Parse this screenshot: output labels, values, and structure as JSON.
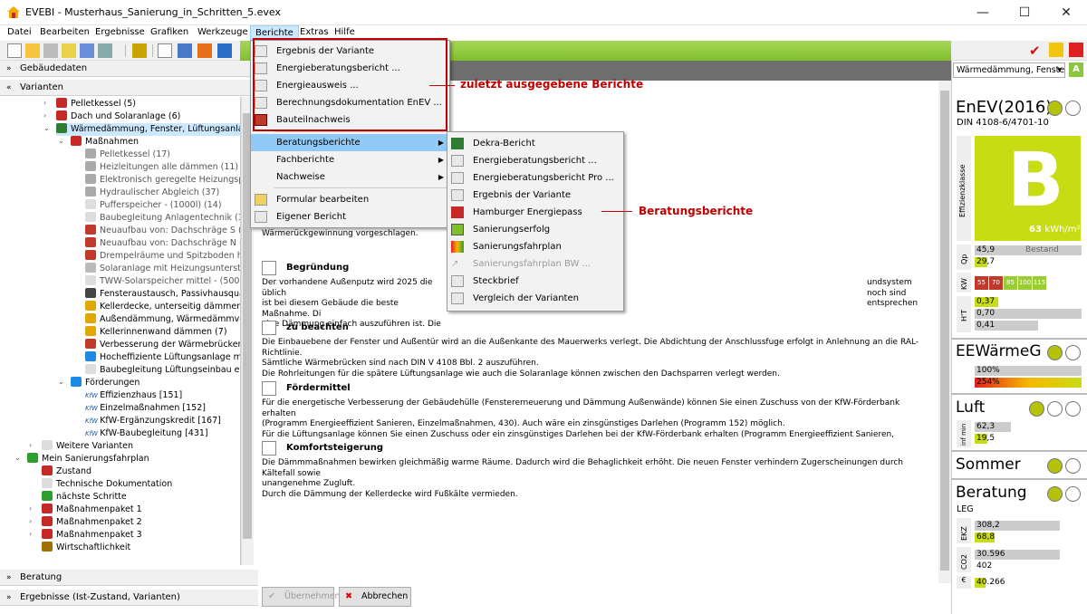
{
  "window": {
    "title": "EVEBI - Musterhaus_Sanierung_in_Schritten_5.evex",
    "min": "—",
    "max": "☐",
    "close": "✕"
  },
  "menubar": [
    "Datei",
    "Bearbeiten",
    "Ergebnisse",
    "Grafiken",
    "Werkzeuge",
    "Berichte",
    "Extras",
    "Hilfe"
  ],
  "left": {
    "gebaeudedaten": "Gebäudedaten",
    "varianten": "Varianten",
    "beratung": "Beratung",
    "ergebnisse": "Ergebnisse (Ist-Zustand, Varianten)"
  },
  "tree": [
    "Pelletkessel (5)",
    "Dach und Solaranlage (6)",
    "Wärmedämmung, Fenster, Lüftungsanlage (",
    "Maßnahmen",
    "Pelletkessel (17)",
    "Heizleitungen alle dämmen (11)",
    "Elektronisch geregelte Heizungspump",
    "Hydraulischer Abgleich (37)",
    "Pufferspeicher - (1000l) (14)",
    "Baubegleitung Anlagentechnik (36)",
    "Neuaufbau von: Dachschräge S (8)",
    "Neuaufbau von: Dachschräge N (9)",
    "Drempelräume und Spitzboden hinzu",
    "Solaranlage mit Heizungsunterstütz",
    "TWW-Solarspeicher mittel - (500 l) (2",
    "Fensteraustausch, Passivhausqualitä",
    "Kellerdecke, unterseitig dämmen (1)",
    "Außendämmung, Wärmedämmverbu",
    "Kellerinnenwand dämmen (7)",
    "Verbesserung der Wärmebrücken, pa",
    "Hocheffiziente Lüftungsanlage mit W",
    "Baubegleitung Lüftungseinbau etc. (",
    "Förderungen",
    "Effizienzhaus [151]",
    "Einzelmaßnahmen [152]",
    "KfW-Ergänzungskredit [167]",
    "KfW-Baubegleitung [431]",
    "Weitere Varianten",
    "Mein Sanierungsfahrplan",
    "Zustand",
    "Technische Dokumentation",
    "nächste Schritte",
    "Maßnahmenpaket 1",
    "Maßnahmenpaket 2",
    "Maßnahmenpaket 3",
    "Wirtschaftlichkeit"
  ],
  "kfw_prefix": "KfW",
  "berichte_menu": {
    "recent": [
      "Ergebnis der Variante",
      "Energieberatungsbericht ...",
      "Energieausweis ...",
      "Berechnungsdokumentation EnEV ...",
      "Bauteilnachweis"
    ],
    "sub": [
      "Beratungsberichte",
      "Fachberichte",
      "Nachweise"
    ],
    "other": [
      "Formular bearbeiten",
      "Eigener Bericht"
    ]
  },
  "beratungsberichte_menu": [
    "Dekra-Bericht",
    "Energieberatungsbericht ...",
    "Energieberatungsbericht Pro ...",
    "Ergebnis der Variante",
    "Hamburger Energiepass",
    "Sanierungserfolg",
    "Sanierungsfahrplan",
    "Sanierungsfahrplan BW ...",
    "Steckbrief",
    "Vergleich der Varianten"
  ],
  "annotations": {
    "recent": "zuletzt ausgegebene Berichte",
    "beratung": "Beratungsberichte"
  },
  "content": {
    "intro": "Wärmerückgewinnung vorgeschlagen.",
    "begruendung_title": "Begründung",
    "begruendung_text": "Der vorhandene Außenputz wird 2025 die üblich\nist bei diesem Gebäude die beste Maßnahme. Di\neine Dämmung einfach auszuführen ist. Die",
    "begruendung_right": "undsystem\nnoch sind\nentsprechen",
    "beachten_title": "zu beachten",
    "beachten_text": "Die Einbauebene der Fenster und Außentür wird an die Außenkante des Mauerwerks verlegt. Die Abdichtung der Anschlussfuge erfolgt in Anlehnung an die RAL-Richtlinie.\nSämtliche Wärmebrücken sind nach DIN V 4108 Bbl. 2 auszuführen.\nDie Rohrleitungen für die spätere Lüftungsanlage wie auch die Solaranlage können zwischen den Dachsparren verlegt werden.",
    "foerder_title": "Fördermittel",
    "foerder_text": "Für die energetische Verbesserung der Gebäudehülle (Fenstererneuerung und Dämmung Außenwände) können Sie einen Zuschuss von der KfW-Förderbank erhalten\n(Programm Energieeffizient Sanieren, Einzelmaßnahmen, 430). Auch wäre ein zinsgünstiges Darlehen (Programm 152) möglich.\nFür die Lüftungsanlage können Sie einen Zuschuss oder ein zinsgünstiges Darlehen bei der KfW-Förderbank erhalten (Programm Energieeffizient Sanieren,",
    "komfort_title": "Komfortsteigerung",
    "komfort_text": "Die Dämmmaßnahmen bewirken gleichmäßig warme Räume. Dadurch wird die Behaglichkeit erhöht. Die neuen Fenster verhindern Zugerscheinungen durch Kältefall sowie\nunangenehme Zugluft.\nDurch die Dämmung der Kellerdecke wird Fußkälte vermieden.",
    "btn_ok": "Übernehmen",
    "btn_cancel": "Abbrechen"
  },
  "right": {
    "variant": "Wärmedämmung, Fenster",
    "enev": "EnEV(2016)",
    "din": "DIN 4108-6/4701-10",
    "effizienz_label": "Effizienzklasse",
    "klasse": "B",
    "kwh": "63",
    "kwh_unit": "kWh/m²",
    "qp_label": "Qp",
    "qp_bestand": "45,9",
    "bestand_label": "Bestand",
    "qp_val": "29,7",
    "kw_label": "KW",
    "kw_values": [
      "55",
      "70",
      "85",
      "100",
      "115"
    ],
    "ht_label": "H'T",
    "ht_values": [
      "0,37",
      "0,70",
      "0,41"
    ],
    "ee": "EEWärmeG",
    "ee_values": [
      "100%",
      "254%"
    ],
    "luft": "Luft",
    "luft_label": "inf min",
    "luft_values": [
      "62,3",
      "19,5"
    ],
    "sommer": "Sommer",
    "beratung": "Beratung",
    "leg": "LEG",
    "ekz_label": "EKZ",
    "ekz_values": [
      "308,2",
      "68,8"
    ],
    "co2_label": "CO2",
    "co2_values": [
      "30.596",
      "402"
    ],
    "euro_label": "€",
    "euro_value": "40.266"
  },
  "colors": {
    "accent": "#7fbf2a",
    "class_green": "#c8dc14",
    "menu_highlight": "#91c9f7",
    "annotation": "#c00000"
  }
}
